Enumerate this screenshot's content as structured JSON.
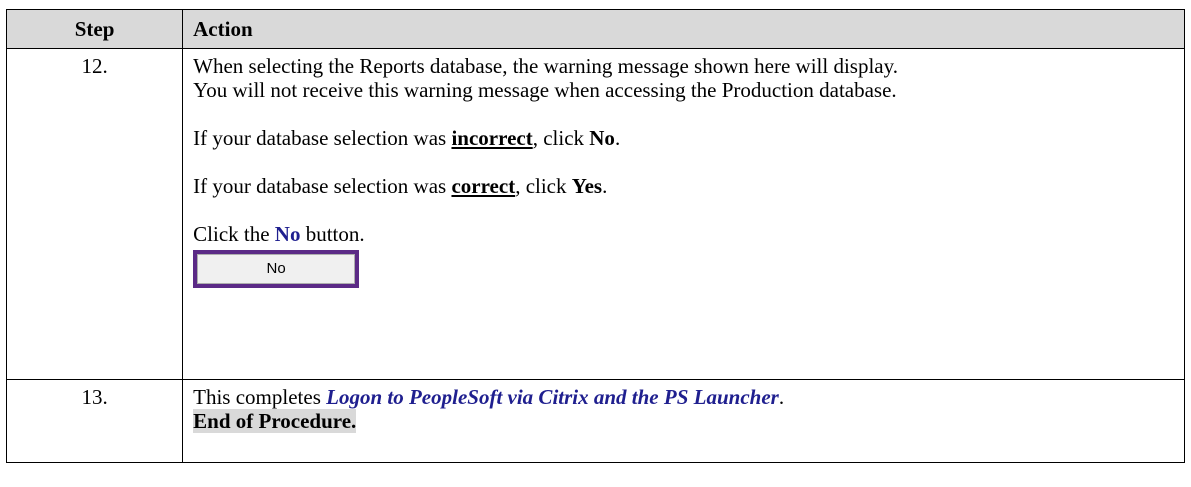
{
  "table": {
    "headers": {
      "step": "Step",
      "action": "Action"
    },
    "rows": [
      {
        "step": "12.",
        "p1": "When selecting the Reports database, the warning message shown here will display.",
        "p2": "You will not receive this warning message when accessing the Production database.",
        "p3": {
          "pre": "If your database selection was ",
          "emph": "incorrect",
          "mid": ", click ",
          "action": "No",
          "post": "."
        },
        "p4": {
          "pre": "If your database selection was ",
          "emph": "correct",
          "mid": ", click ",
          "action": "Yes",
          "post": "."
        },
        "p5": {
          "pre": "Click the ",
          "button_ref": "No",
          "post": " button."
        },
        "button_image_label": "No"
      },
      {
        "step": "13.",
        "p1": {
          "pre": "This completes ",
          "title": "Logon to PeopleSoft via Citrix and the PS Launcher",
          "post": "."
        },
        "end_label": "End of Procedure."
      }
    ]
  },
  "colors": {
    "header_bg": "#d9d9d9",
    "link_blue": "#1f1f8f",
    "button_border": "#5b2a86"
  }
}
